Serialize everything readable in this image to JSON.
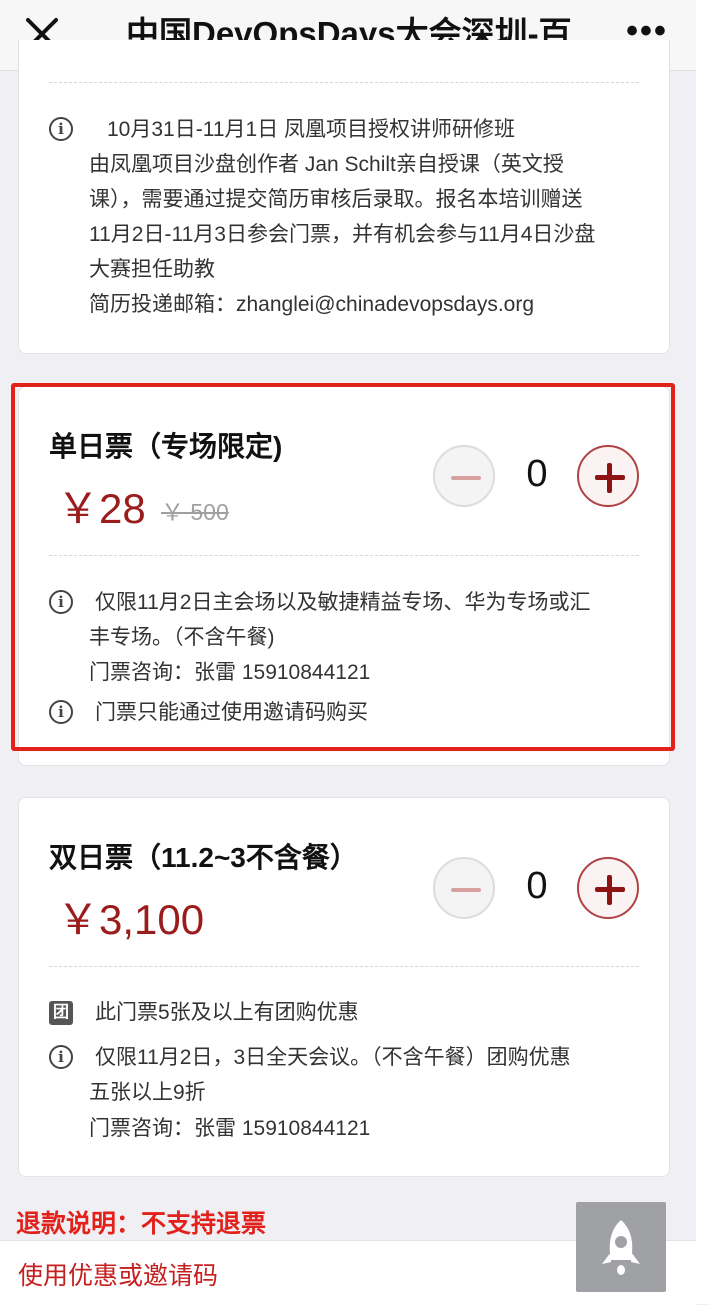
{
  "top_bar": {
    "title": "中国DevOpsDays大会深圳-百",
    "more_label": "•••"
  },
  "prev_ticket": {
    "info_line1": "10月31日-11月1日 凤凰项目授权讲师研修班",
    "info_line2": "由凤凰项目沙盘创作者 Jan Schilt亲自授课（英文授",
    "info_line3": "课），需要通过提交简历审核后录取。报名本培训赠送",
    "info_line4": "11月2日-11月3日参会门票，并有机会参与11月4日沙盘",
    "info_line5": "大赛担任助教",
    "info_line6": "简历投递邮箱：zhanglei@chinadevopsdays.org"
  },
  "ticket_single": {
    "name": "单日票（专场限定)",
    "price": "￥28",
    "original_price": "￥ 500",
    "quantity": "0",
    "info1_line1": "仅限11月2日主会场以及敏捷精益专场、华为专场或汇",
    "info1_line2": "丰专场。（不含午餐)",
    "consult": "门票咨询：张雷 15910844121",
    "info2": "门票只能通过使用邀请码购买"
  },
  "ticket_double": {
    "name": "双日票（11.2~3不含餐）",
    "price": "￥3,100",
    "quantity": "0",
    "group_note": "此门票5张及以上有团购优惠",
    "group_icon_label": "团",
    "info_line1": "仅限11月2日，3日全天会议。（不含午餐）团购优惠",
    "info_line2": "五张以上9折",
    "consult": "门票咨询：张雷 15910844121"
  },
  "info_icon_glyph": "i",
  "refund_note": "退款说明：不支持退票",
  "coupon_link": "使用优惠或邀请码",
  "colors": {
    "accent_red": "#e3211b",
    "price_red": "#9b1c1c",
    "plus_red": "#8e1414"
  }
}
